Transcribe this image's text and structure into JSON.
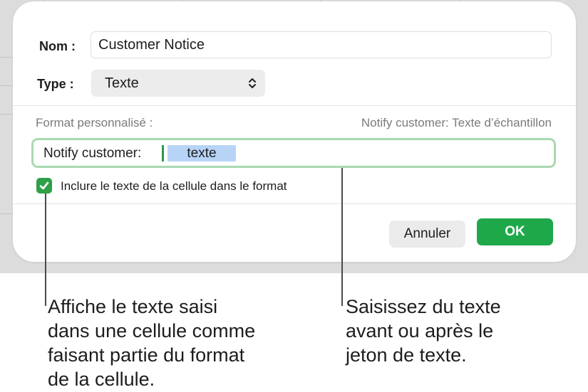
{
  "dialog": {
    "name_label": "Nom :",
    "name_value": "Customer Notice",
    "type_label": "Type :",
    "type_value": "Texte",
    "custom_format_label": "Format personnalisé :",
    "sample_text": "Notify customer: Texte d’échantillon",
    "format_prefix": "Notify customer:",
    "token_label": "texte",
    "checkbox_label": "Inclure le texte de la cellule dans le format",
    "checkbox_checked": true,
    "cancel_label": "Annuler",
    "ok_label": "OK"
  },
  "callouts": {
    "left": [
      "Affiche le texte saisi",
      "dans une cellule comme",
      "faisant partie du format",
      "de la cellule."
    ],
    "right": [
      "Saisissez du texte",
      "avant ou après le",
      "jeton de texte."
    ]
  },
  "colors": {
    "accent_green": "#1fa84a",
    "field_border_green": "#a9d9b1",
    "token_blue": "#b7d4f7"
  },
  "icons": {
    "type_select": "chevron-up-down-icon",
    "checkbox": "checkmark-icon"
  }
}
